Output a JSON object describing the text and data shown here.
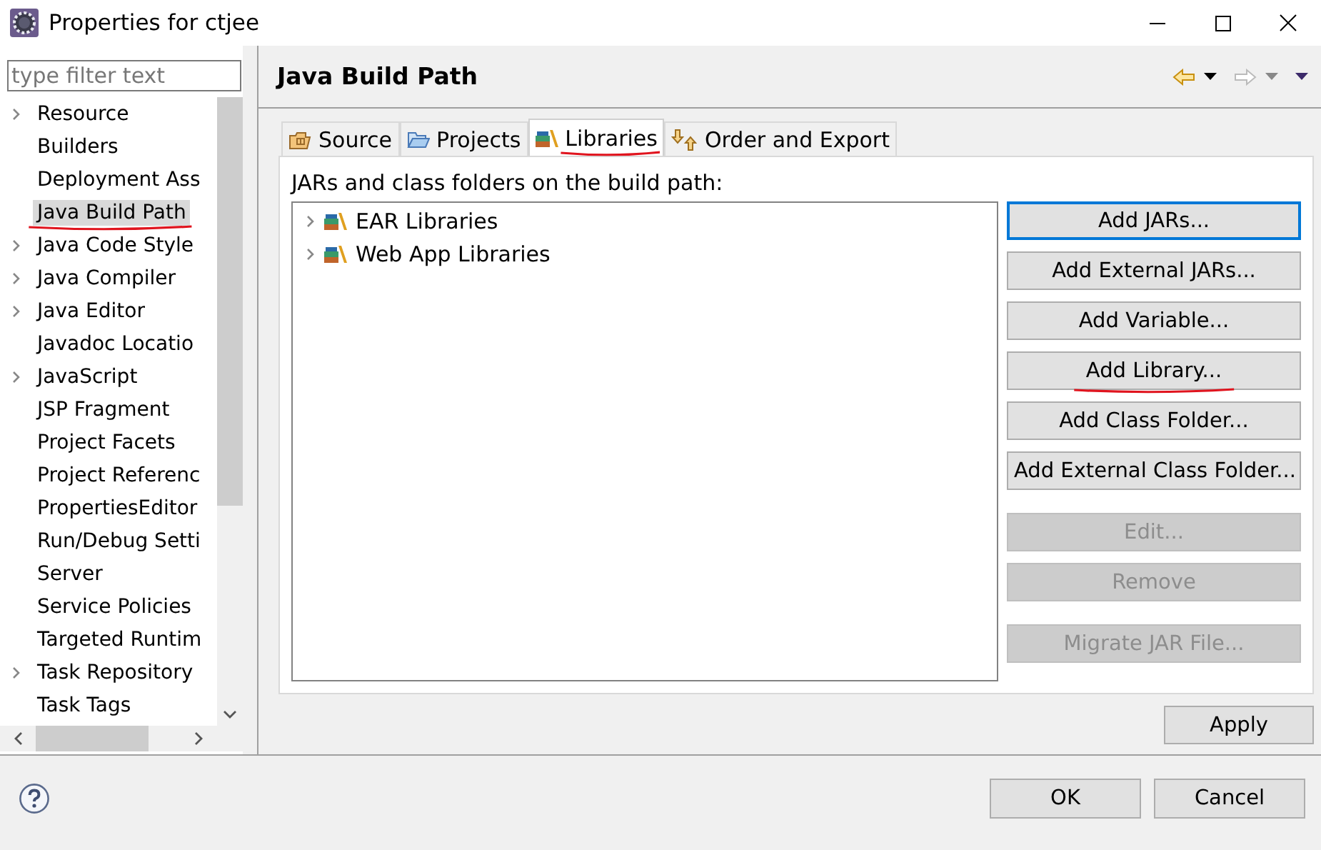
{
  "window": {
    "title": "Properties for ctjee"
  },
  "filter": {
    "placeholder": "type filter text"
  },
  "sidebar": {
    "items": [
      {
        "label": "Resource",
        "expandable": true,
        "selected": false,
        "marked": false
      },
      {
        "label": "Builders",
        "expandable": false,
        "selected": false,
        "marked": false
      },
      {
        "label": "Deployment Ass",
        "expandable": false,
        "selected": false,
        "marked": false
      },
      {
        "label": "Java Build Path",
        "expandable": false,
        "selected": true,
        "marked": true
      },
      {
        "label": "Java Code Style",
        "expandable": true,
        "selected": false,
        "marked": false
      },
      {
        "label": "Java Compiler",
        "expandable": true,
        "selected": false,
        "marked": false
      },
      {
        "label": "Java Editor",
        "expandable": true,
        "selected": false,
        "marked": false
      },
      {
        "label": "Javadoc Locatio",
        "expandable": false,
        "selected": false,
        "marked": false
      },
      {
        "label": "JavaScript",
        "expandable": true,
        "selected": false,
        "marked": false
      },
      {
        "label": "JSP Fragment",
        "expandable": false,
        "selected": false,
        "marked": false
      },
      {
        "label": "Project Facets",
        "expandable": false,
        "selected": false,
        "marked": false
      },
      {
        "label": "Project Referenc",
        "expandable": false,
        "selected": false,
        "marked": false
      },
      {
        "label": "PropertiesEditor",
        "expandable": false,
        "selected": false,
        "marked": false
      },
      {
        "label": "Run/Debug Setti",
        "expandable": false,
        "selected": false,
        "marked": false
      },
      {
        "label": "Server",
        "expandable": false,
        "selected": false,
        "marked": false
      },
      {
        "label": "Service Policies",
        "expandable": false,
        "selected": false,
        "marked": false
      },
      {
        "label": "Targeted Runtim",
        "expandable": false,
        "selected": false,
        "marked": false
      },
      {
        "label": "Task Repository",
        "expandable": true,
        "selected": false,
        "marked": false
      },
      {
        "label": "Task Tags",
        "expandable": false,
        "selected": false,
        "marked": false
      }
    ]
  },
  "page": {
    "title": "Java Build Path"
  },
  "tabs": [
    {
      "label": "Source",
      "selected": false,
      "marked": false
    },
    {
      "label": "Projects",
      "selected": false,
      "marked": false
    },
    {
      "label": "Libraries",
      "selected": true,
      "marked": true
    },
    {
      "label": "Order and Export",
      "selected": false,
      "marked": false
    }
  ],
  "libraries": {
    "caption": "JARs and class folders on the build path:",
    "items": [
      {
        "label": "EAR Libraries",
        "expanded": false
      },
      {
        "label": "Web App Libraries",
        "expanded": false
      }
    ]
  },
  "button_groups": [
    [
      {
        "label": "Add JARs...",
        "disabled": false,
        "focused": true,
        "marked": false
      },
      {
        "label": "Add External JARs...",
        "disabled": false,
        "focused": false,
        "marked": false
      },
      {
        "label": "Add Variable...",
        "disabled": false,
        "focused": false,
        "marked": false
      },
      {
        "label": "Add Library...",
        "disabled": false,
        "focused": false,
        "marked": true
      },
      {
        "label": "Add Class Folder...",
        "disabled": false,
        "focused": false,
        "marked": false
      },
      {
        "label": "Add External Class Folder...",
        "disabled": false,
        "focused": false,
        "marked": false
      }
    ],
    [
      {
        "label": "Edit...",
        "disabled": true,
        "focused": false,
        "marked": false
      },
      {
        "label": "Remove",
        "disabled": true,
        "focused": false,
        "marked": false
      }
    ],
    [
      {
        "label": "Migrate JAR File...",
        "disabled": true,
        "focused": false,
        "marked": false
      }
    ]
  ],
  "apply_button": "Apply",
  "dialog_buttons": [
    "OK",
    "Cancel"
  ]
}
